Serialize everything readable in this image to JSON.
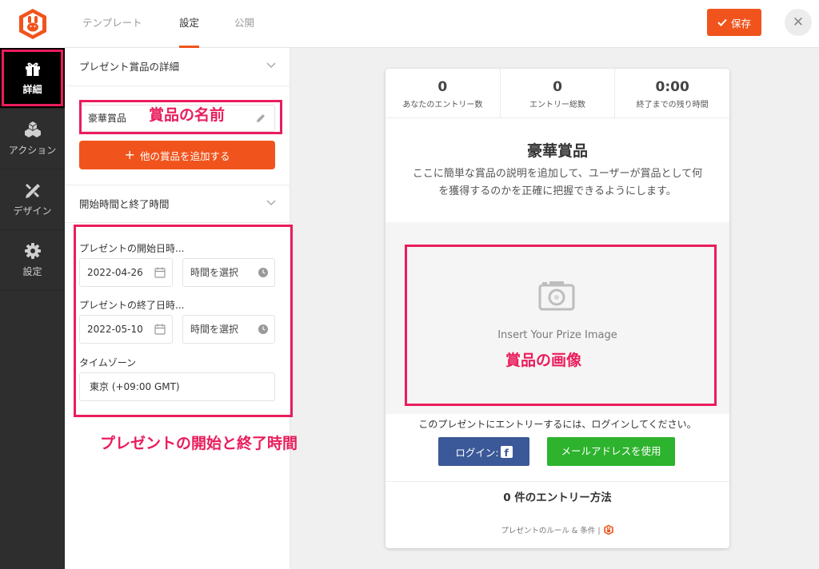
{
  "topbar": {
    "tabs": [
      {
        "label": "テンプレート"
      },
      {
        "label": "設定"
      },
      {
        "label": "公開"
      }
    ],
    "save_label": "保存"
  },
  "sidebar": {
    "items": [
      {
        "label": "詳細",
        "icon": "gift-icon"
      },
      {
        "label": "アクション",
        "icon": "cubes-icon"
      },
      {
        "label": "デザイン",
        "icon": "design-tools-icon"
      },
      {
        "label": "設定",
        "icon": "gear-icon"
      }
    ]
  },
  "panel": {
    "prize_section_title": "プレゼント賞品の詳細",
    "prize_name_value": "豪華賞品",
    "add_prize_label": "他の賞品を追加する",
    "time_section_title": "開始時間と終了時間",
    "start_label": "プレゼントの開始日時...",
    "start_date": "2022-04-26",
    "start_time_placeholder": "時間を選択",
    "end_label": "プレゼントの終了日時...",
    "end_date": "2022-05-10",
    "end_time_placeholder": "時間を選択",
    "timezone_label": "タイムゾーン",
    "timezone_value": "東京 (+09:00 GMT)"
  },
  "annotations": {
    "prize_name": "賞品の名前",
    "prize_image": "賞品の画像",
    "time": "プレゼントの開始と終了時間"
  },
  "preview": {
    "stats": [
      {
        "value": "0",
        "label": "あなたのエントリー数"
      },
      {
        "value": "0",
        "label": "エントリー総数"
      },
      {
        "value": "0:00",
        "label": "終了までの残り時間"
      }
    ],
    "prize_title": "豪華賞品",
    "prize_description": "ここに簡単な賞品の説明を追加して、ユーザーが賞品として何を獲得するのかを正確に把握できるようにします。",
    "image_placeholder": "Insert Your Prize Image",
    "login_prompt": "このプレゼントにエントリーするには、ログインしてください。",
    "fb_login_label": "ログイン:",
    "email_label": "メールアドレスを使用",
    "entry_methods": "0 件のエントリー方法",
    "footer_text": "プレゼントのルール & 条件 |"
  },
  "colors": {
    "accent": "#f0541c",
    "annotation": "#ea1d5c",
    "facebook": "#3b5998",
    "email": "#2db32d"
  }
}
